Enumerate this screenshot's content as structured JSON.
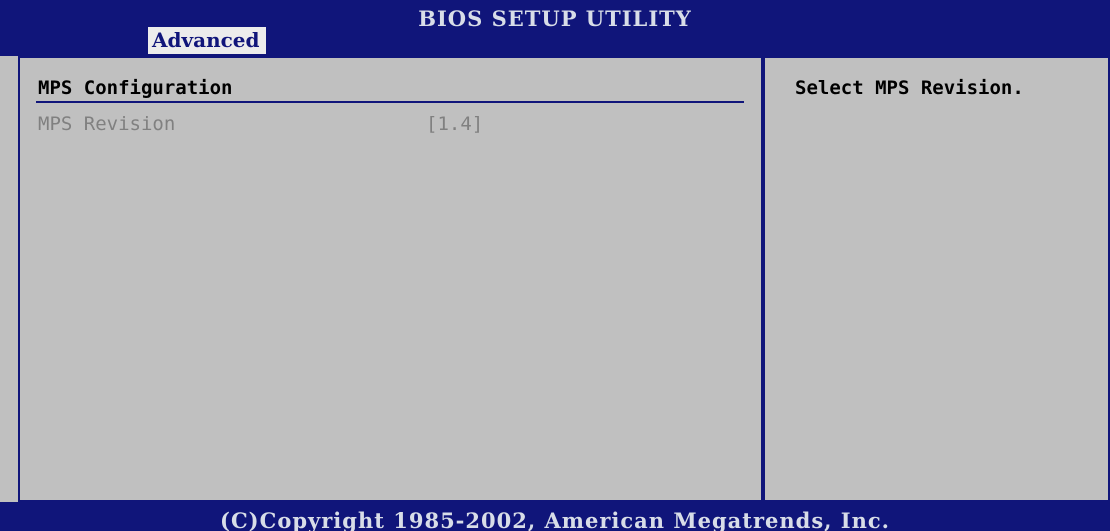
{
  "header": {
    "title": "BIOS SETUP UTILITY",
    "active_tab": "Advanced"
  },
  "main": {
    "section_title": "MPS Configuration",
    "items": [
      {
        "label": "MPS Revision",
        "value": "[1.4]"
      }
    ]
  },
  "help": {
    "text": "Select MPS Revision."
  },
  "footer": {
    "copyright": "(C)Copyright 1985-2002, American Megatrends, Inc."
  },
  "colors": {
    "bar_blue": "#10157a",
    "panel_gray": "#c0c0c0",
    "disabled_text": "#808080",
    "tab_highlight": "#ececec"
  }
}
